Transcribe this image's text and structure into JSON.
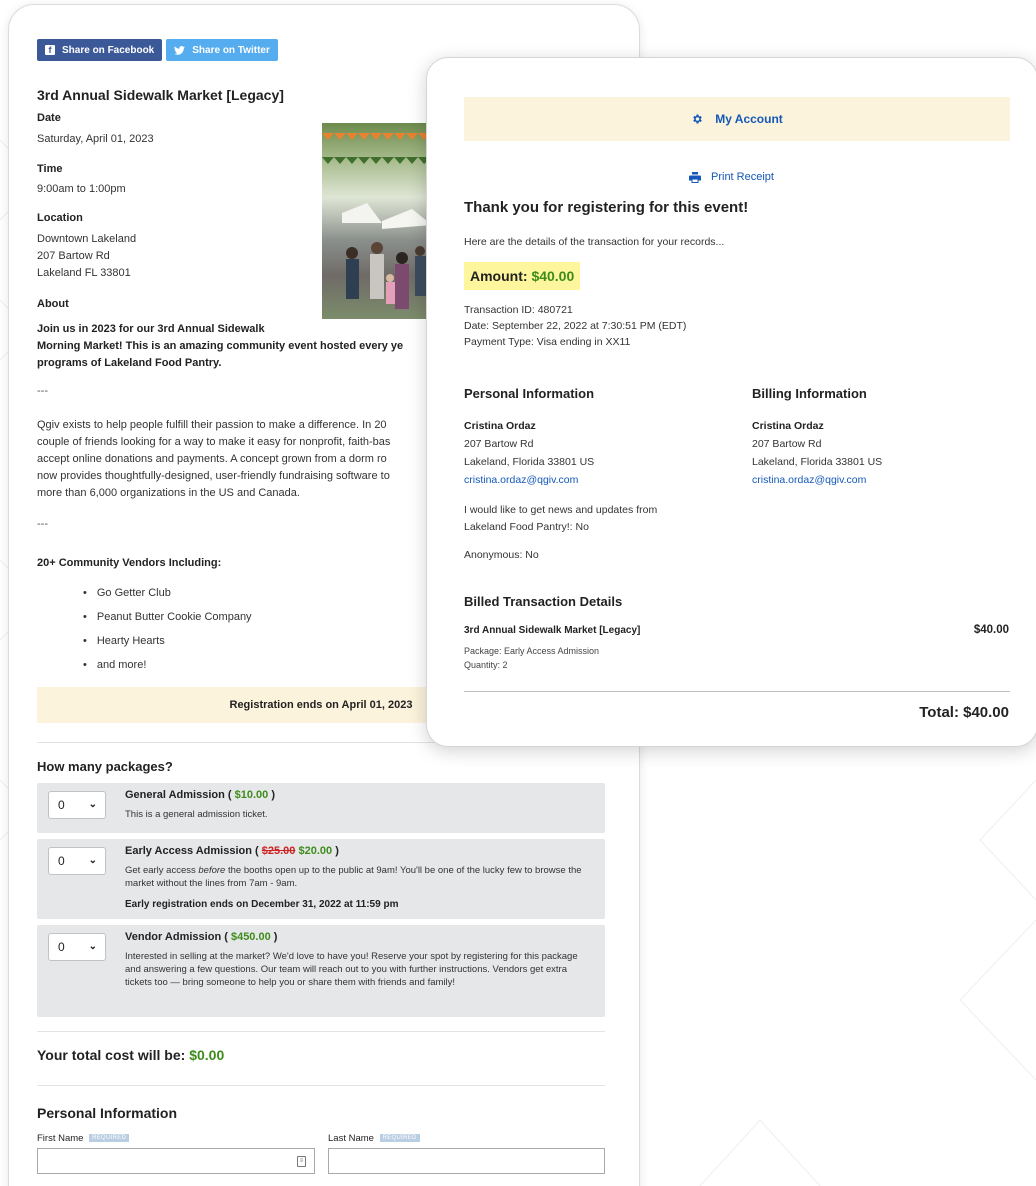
{
  "share": {
    "facebook_label": "Share on Facebook",
    "twitter_label": "Share on Twitter"
  },
  "event": {
    "title": "3rd Annual Sidewalk Market [Legacy]",
    "date_label": "Date",
    "date_value": "Saturday, April 01, 2023",
    "time_label": "Time",
    "time_value": "9:00am to 1:00pm",
    "location_label": "Location",
    "location_lines": [
      "Downtown Lakeland",
      "207 Bartow Rd",
      "Lakeland FL 33801"
    ],
    "about_label": "About",
    "about_bold_1": "Join us in 2023 for our 3rd Annual Sidewalk",
    "about_bold_2": "Morning Market! This is an amazing community event hosted every ye",
    "about_bold_3": "programs of Lakeland Food Pantry.",
    "separator": "---",
    "about_text_lines": [
      "Qgiv exists to help people fulfill their passion to make a difference. In 20",
      "couple of friends looking for a way to make it easy for nonprofit, faith-bas",
      "accept online donations and payments. A concept grown from a dorm ro",
      "now provides thoughtfully-designed, user-friendly fundraising software to",
      "more than 6,000 organizations in the US and Canada."
    ],
    "vendors_title": "20+ Community Vendors Including:",
    "vendors": [
      "Go Getter Club",
      "Peanut Butter Cookie Company",
      "Hearty Hearts",
      "and more!"
    ],
    "registration_ends": "Registration ends on April 01, 2023"
  },
  "packages": {
    "heading": "How many packages?",
    "items": [
      {
        "qty": "0",
        "name": "General Admission (",
        "price": "$10.00",
        "close": ")",
        "desc": "This is a general admission ticket."
      },
      {
        "qty": "0",
        "name": "Early Access Admission (",
        "old_price": "$25.00",
        "price": "$20.00",
        "close": ")",
        "desc_pre": "Get early access ",
        "desc_em": "before",
        "desc_post": " the booths open up to the public at 9am! You'll be one of the lucky few to browse the market without the lines from 7am - 9am.",
        "note": "Early registration ends on December 31, 2022 at 11:59 pm"
      },
      {
        "qty": "0",
        "name": "Vendor Admission (",
        "price": "$450.00",
        "close": ")",
        "desc": "Interested in selling at the market? We'd love to have you! Reserve your spot by registering for this package and answering a few questions. Our team will reach out to you with further instructions. Vendors get extra tickets too — bring someone to help you or share them with friends and family!"
      }
    ],
    "total_label": "Your total cost will be:",
    "total_value": "$0.00"
  },
  "personal_form": {
    "heading": "Personal Information",
    "first_name_label": "First Name",
    "last_name_label": "Last Name",
    "required_badge": "REQUIRED",
    "first_name_value": "",
    "last_name_value": ""
  },
  "receipt": {
    "my_account": "My Account",
    "print_receipt": "Print Receipt",
    "thanks": "Thank you for registering for this event!",
    "records": "Here are the details of the transaction for your records...",
    "amount_label": "Amount:",
    "amount_value": "$40.00",
    "transaction_id": "Transaction ID: 480721",
    "date": "Date: September 22, 2022 at 7:30:51 PM (EDT)",
    "payment_type": "Payment Type: Visa ending in XX11",
    "personal": {
      "heading": "Personal Information",
      "name": "Cristina Ordaz",
      "street": "207 Bartow Rd",
      "city": "Lakeland, Florida 33801 US",
      "email": "cristina.ordaz@qgiv.com"
    },
    "billing": {
      "heading": "Billing Information",
      "name": "Cristina Ordaz",
      "street": "207 Bartow Rd",
      "city": "Lakeland, Florida 33801 US",
      "email": "cristina.ordaz@qgiv.com"
    },
    "news_1": "I would like to get news and updates from",
    "news_2": "Lakeland Food Pantry!: No",
    "anonymous": "Anonymous: No",
    "billed_heading": "Billed Transaction Details",
    "item_name": "3rd Annual Sidewalk Market [Legacy]",
    "item_price": "$40.00",
    "item_package": "Package: Early Access Admission",
    "item_quantity": "Quantity: 2",
    "total": "Total: $40.00"
  },
  "colors": {
    "accent_blue": "#1458b8",
    "price_green": "#3e8c1b",
    "highlight_yellow": "#fdf69c",
    "banner_cream": "#fbf3dc",
    "facebook_blue": "#3b5998",
    "twitter_blue": "#55acee"
  }
}
